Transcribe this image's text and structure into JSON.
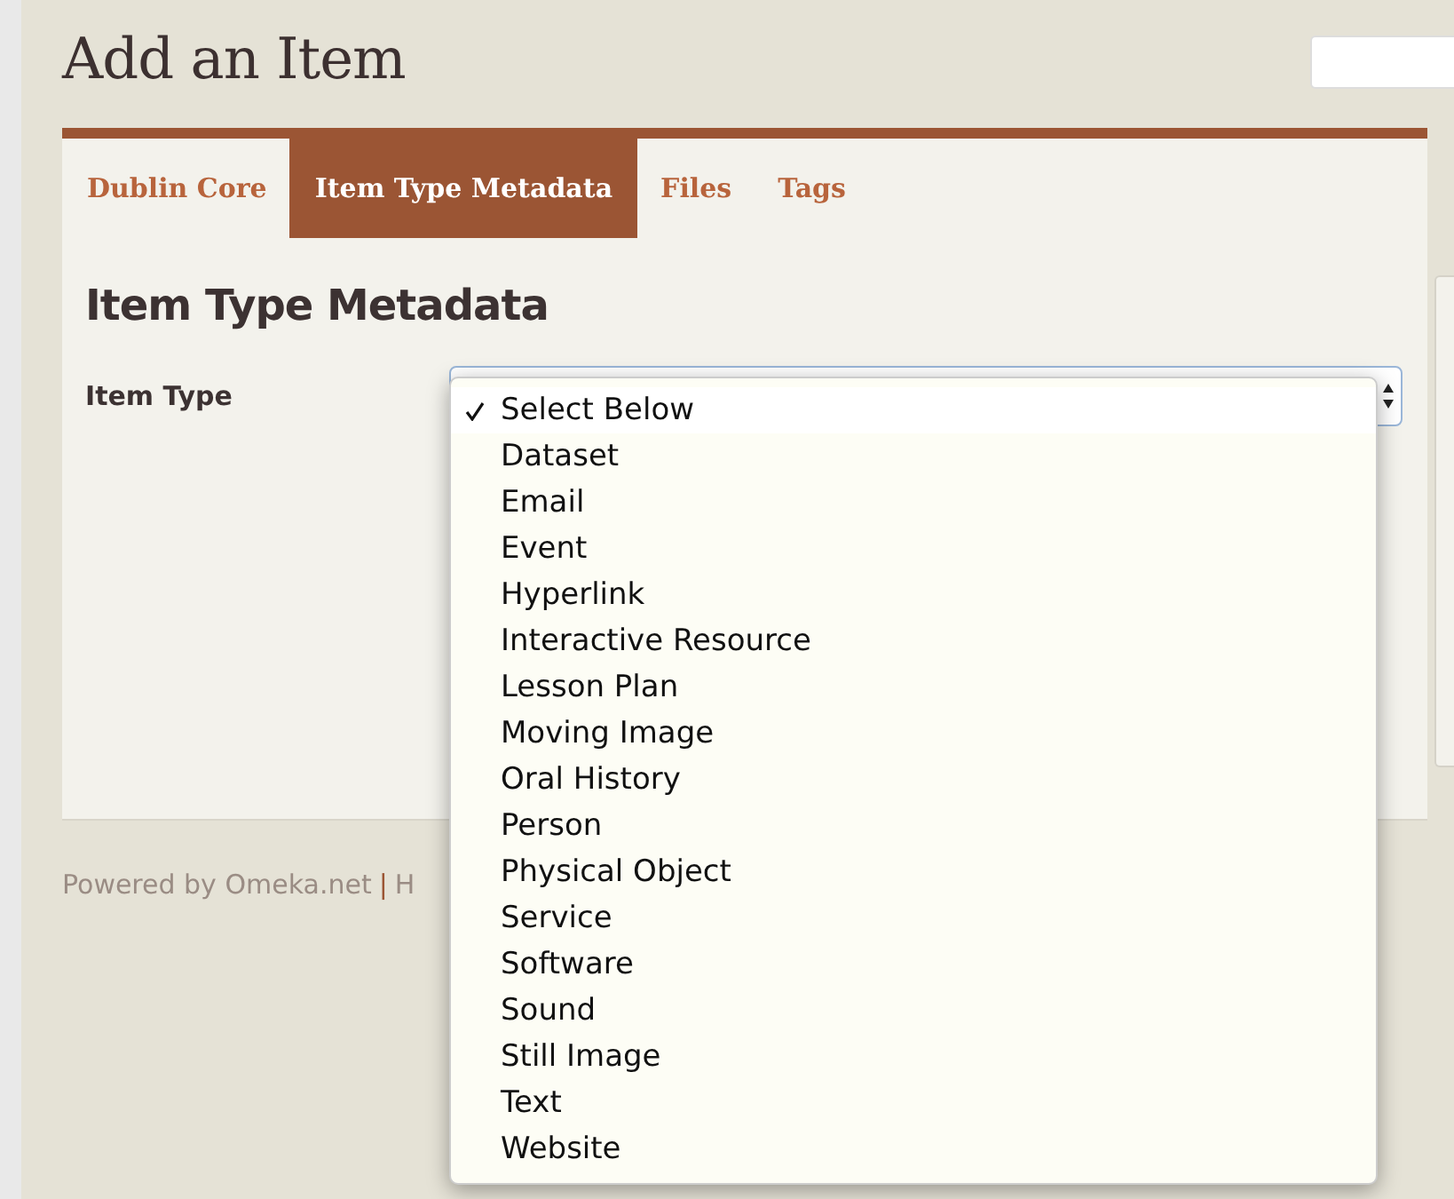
{
  "page": {
    "title": "Add an Item"
  },
  "tabs": [
    {
      "label": "Dublin Core",
      "selected": false
    },
    {
      "label": "Item Type Metadata",
      "selected": true
    },
    {
      "label": "Files",
      "selected": false
    },
    {
      "label": "Tags",
      "selected": false
    }
  ],
  "section": {
    "heading": "Item Type Metadata",
    "field_label": "Item Type"
  },
  "dropdown": {
    "options": [
      {
        "label": "Select Below",
        "selected": true
      },
      {
        "label": "Dataset",
        "selected": false
      },
      {
        "label": "Email",
        "selected": false
      },
      {
        "label": "Event",
        "selected": false
      },
      {
        "label": "Hyperlink",
        "selected": false
      },
      {
        "label": "Interactive Resource",
        "selected": false
      },
      {
        "label": "Lesson Plan",
        "selected": false
      },
      {
        "label": "Moving Image",
        "selected": false
      },
      {
        "label": "Oral History",
        "selected": false
      },
      {
        "label": "Person",
        "selected": false
      },
      {
        "label": "Physical Object",
        "selected": false
      },
      {
        "label": "Service",
        "selected": false
      },
      {
        "label": "Software",
        "selected": false
      },
      {
        "label": "Sound",
        "selected": false
      },
      {
        "label": "Still Image",
        "selected": false
      },
      {
        "label": "Text",
        "selected": false
      },
      {
        "label": "Website",
        "selected": false
      }
    ]
  },
  "footer": {
    "link": "Powered by Omeka.net",
    "separator": "|",
    "text": "H"
  }
}
